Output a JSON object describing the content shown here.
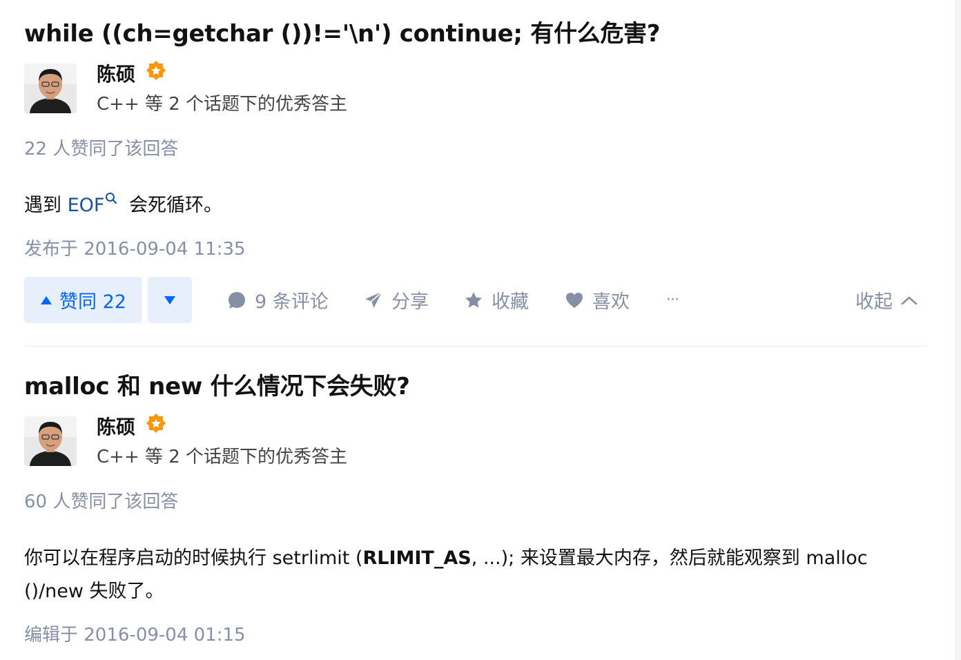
{
  "answers": [
    {
      "question_title": "while ((ch=getchar ())!='\\n') continue; 有什么危害?",
      "author_name": "陈硕",
      "author_desc": "C++ 等 2 个话题下的优秀答主",
      "upvote_text": "22 人赞同了该回答",
      "content": {
        "before": "遇到 ",
        "link": "EOF",
        "after": " 会死循环。"
      },
      "timestamp": "发布于 2016-09-04 11:35",
      "actions": {
        "vote_up_label": "赞同 22",
        "comments_label": "9 条评论",
        "share_label": "分享",
        "favorite_label": "收藏",
        "like_label": "喜欢",
        "more_label": "···",
        "collapse_label": "收起"
      }
    },
    {
      "question_title": "malloc 和 new 什么情况下会失败?",
      "author_name": "陈硕",
      "author_desc": "C++ 等 2 个话题下的优秀答主",
      "upvote_text": "60 人赞同了该回答",
      "content": {
        "part1": "你可以在程序启动的时候执行 setrlimit (",
        "bold": "RLIMIT_AS",
        "part2": ", ...); 来设置最大内存，然后就能观察到 malloc ()/new 失败了。"
      },
      "timestamp": "编辑于 2016-09-04 01:15"
    }
  ],
  "colors": {
    "primary_blue": "#0066ff",
    "vote_bg": "#e6effb",
    "meta_gray": "#8590a6",
    "link_blue": "#175199",
    "badge_orange": "#ff9607"
  },
  "icons": [
    "caret-up-icon",
    "caret-down-icon",
    "comment-icon",
    "share-icon",
    "star-icon",
    "heart-icon",
    "more-icon",
    "chevron-up-icon",
    "search-icon",
    "excellent-answerer-badge"
  ]
}
